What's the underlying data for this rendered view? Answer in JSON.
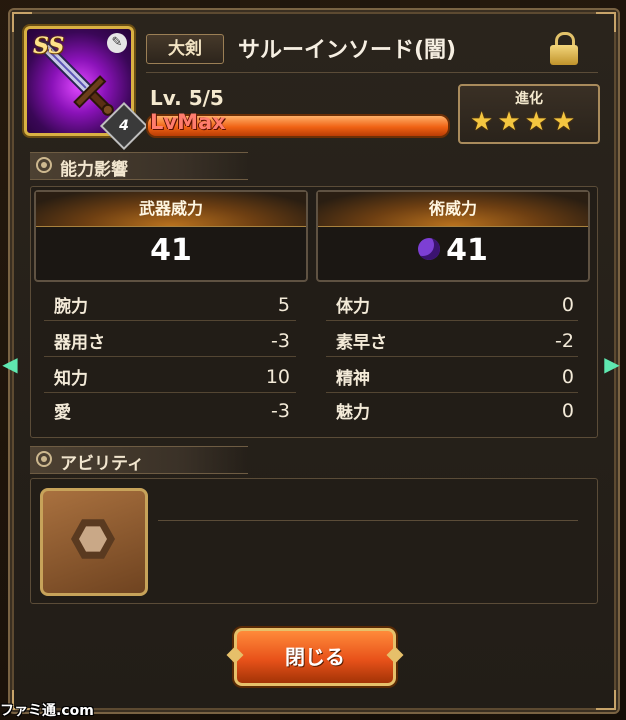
{
  "header": {
    "rank_badge": "SS",
    "category": "大剣",
    "weapon_name": "サルーインソード(闇)",
    "level_label": "Lv. 5/5",
    "level_progress": 1.0,
    "lvmax_label": "LvMax",
    "evolution_label": "進化",
    "evolution_stars": 4,
    "evolution_level": "4",
    "locked": true
  },
  "abilities_section": {
    "title": "能力影響"
  },
  "power": {
    "weapon_power_label": "武器威力",
    "weapon_power_value": "41",
    "skill_power_label": "術威力",
    "skill_power_value": "41"
  },
  "stats": {
    "left": [
      {
        "label": "腕力",
        "value": "5"
      },
      {
        "label": "器用さ",
        "value": "-3"
      },
      {
        "label": "知力",
        "value": "10"
      },
      {
        "label": "愛",
        "value": "-3"
      }
    ],
    "right": [
      {
        "label": "体力",
        "value": "0"
      },
      {
        "label": "素早さ",
        "value": "-2"
      },
      {
        "label": "精神",
        "value": "0"
      },
      {
        "label": "魅力",
        "value": "0"
      }
    ]
  },
  "ability_section": {
    "title": "アビリティ"
  },
  "close_button": "閉じる",
  "watermark": "ファミ通.com",
  "colors": {
    "accent_orange": "#e8521a",
    "gold": "#d9b143",
    "dark_element": "#7d3fd4"
  }
}
